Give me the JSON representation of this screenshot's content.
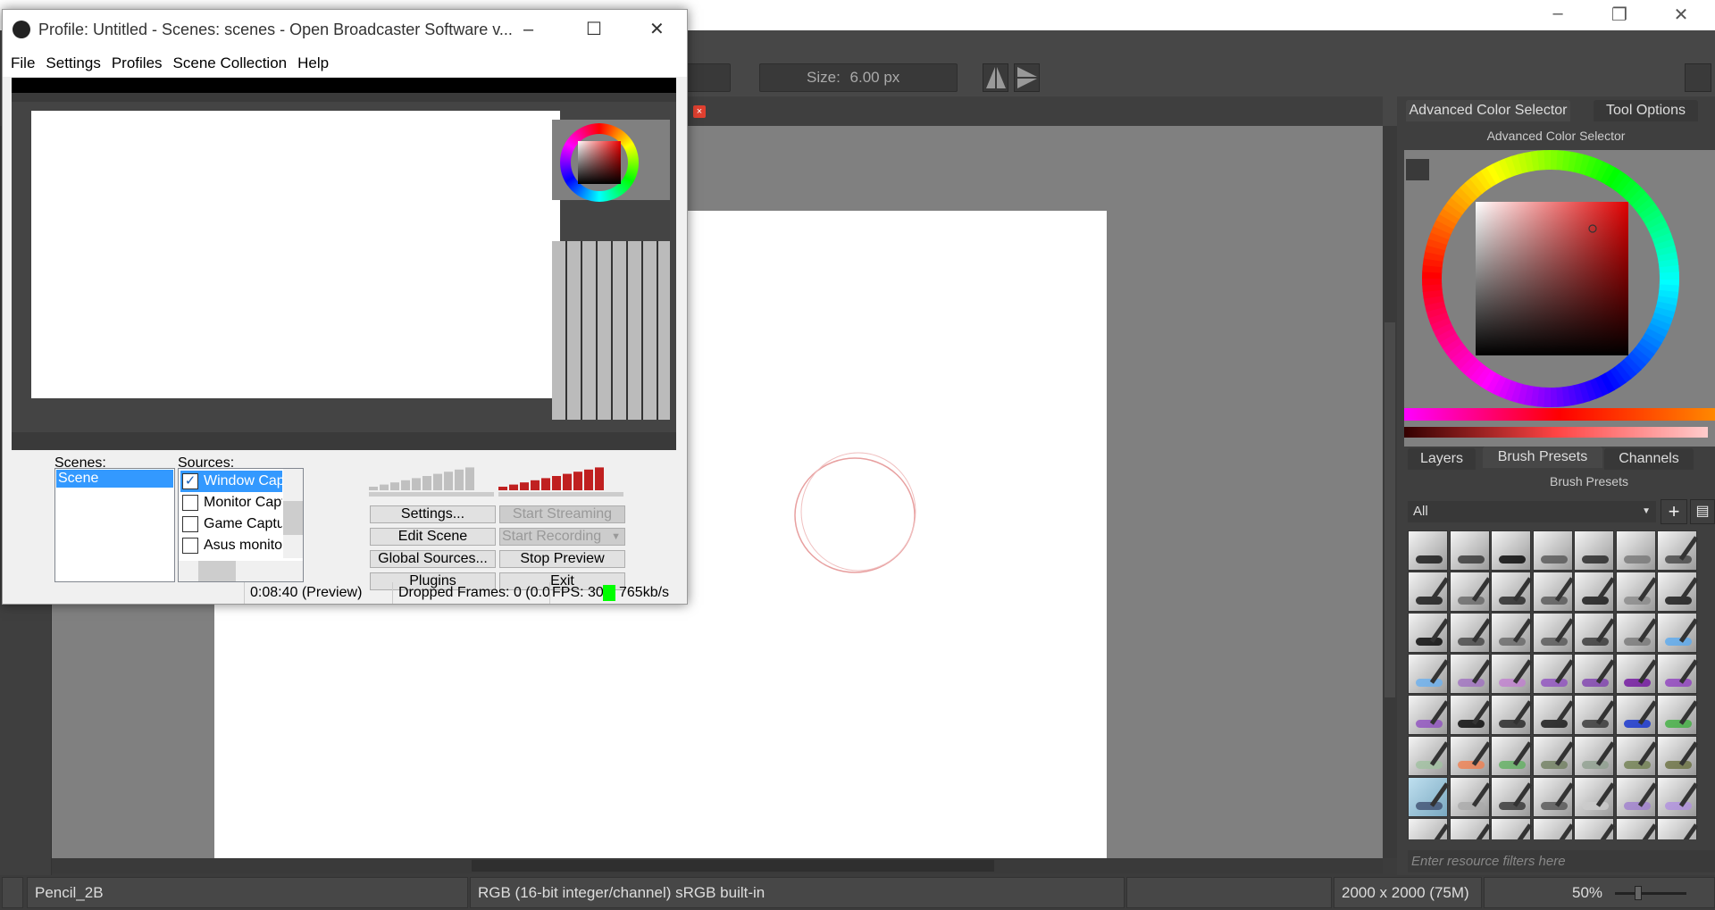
{
  "krita": {
    "toolbar": {
      "size_label": "Size:",
      "size_value": "6.00 px"
    },
    "dock": {
      "top_tabs": [
        "Advanced Color Selector",
        "Tool Options"
      ],
      "color_selector_title": "Advanced Color Selector",
      "bottom_tabs": [
        "Layers",
        "Brush Presets",
        "Channels"
      ],
      "brush_presets_title": "Brush Presets",
      "tag_filter": "All",
      "filter_placeholder": "Enter resource filters here",
      "selected_color": "#b02030",
      "tile_accents": [
        "#111",
        "#333",
        "#000",
        "#555",
        "#222",
        "#777",
        "#444",
        "#111",
        "#666",
        "#222",
        "#555",
        "#111",
        "#888",
        "#111",
        "#000",
        "#444",
        "#666",
        "#555",
        "#333",
        "#777",
        "#5aaaf0",
        "#6ab0f0",
        "#a070c0",
        "#c080d0",
        "#9050c0",
        "#8040b0",
        "#7010a0",
        "#9040c0",
        "#9050c0",
        "#000",
        "#222",
        "#111",
        "#333",
        "#1030d0",
        "#40b040",
        "#a0c0a0",
        "#f08050",
        "#60b060",
        "#708060",
        "#90a090",
        "#708050",
        "#6a7040",
        "#405070",
        "#aaa",
        "#333",
        "#555",
        "#ccc",
        "#a080d0",
        "#b090e0",
        "#a080d0",
        "#8ab0e0",
        "#8ab0e0",
        "#8ab0e0",
        "#555",
        "#222",
        "#999"
      ]
    },
    "status": {
      "brush": "Pencil_2B",
      "color_space": "RGB (16-bit integer/channel)  sRGB built-in",
      "dimensions": "2000 x 2000 (75M)",
      "zoom": "50%"
    }
  },
  "obs": {
    "title": "Profile: Untitled - Scenes: scenes - Open Broadcaster Software v...",
    "menu": [
      "File",
      "Settings",
      "Profiles",
      "Scene Collection",
      "Help"
    ],
    "scenes_label": "Scenes:",
    "scenes": [
      "Scene"
    ],
    "sources_label": "Sources:",
    "sources": [
      {
        "name": "Window Capture",
        "checked": true
      },
      {
        "name": "Monitor Capture",
        "checked": false
      },
      {
        "name": "Game Capture",
        "checked": false
      },
      {
        "name": "Asus monitor",
        "checked": false
      }
    ],
    "buttons": {
      "settings": "Settings...",
      "start_streaming": "Start Streaming",
      "edit_scene": "Edit Scene",
      "start_recording": "Start Recording",
      "global_sources": "Global Sources...",
      "stop_preview": "Stop Preview",
      "plugins": "Plugins",
      "exit": "Exit"
    },
    "mic_level": 1.0,
    "desktop_level": 1.0,
    "status": {
      "time": "0:08:40 (Preview)",
      "dropped": "Dropped Frames: 0 (0.0",
      "fps": "FPS: 30",
      "bitrate": "765kb/s",
      "indicator_color": "#00ff00"
    }
  }
}
